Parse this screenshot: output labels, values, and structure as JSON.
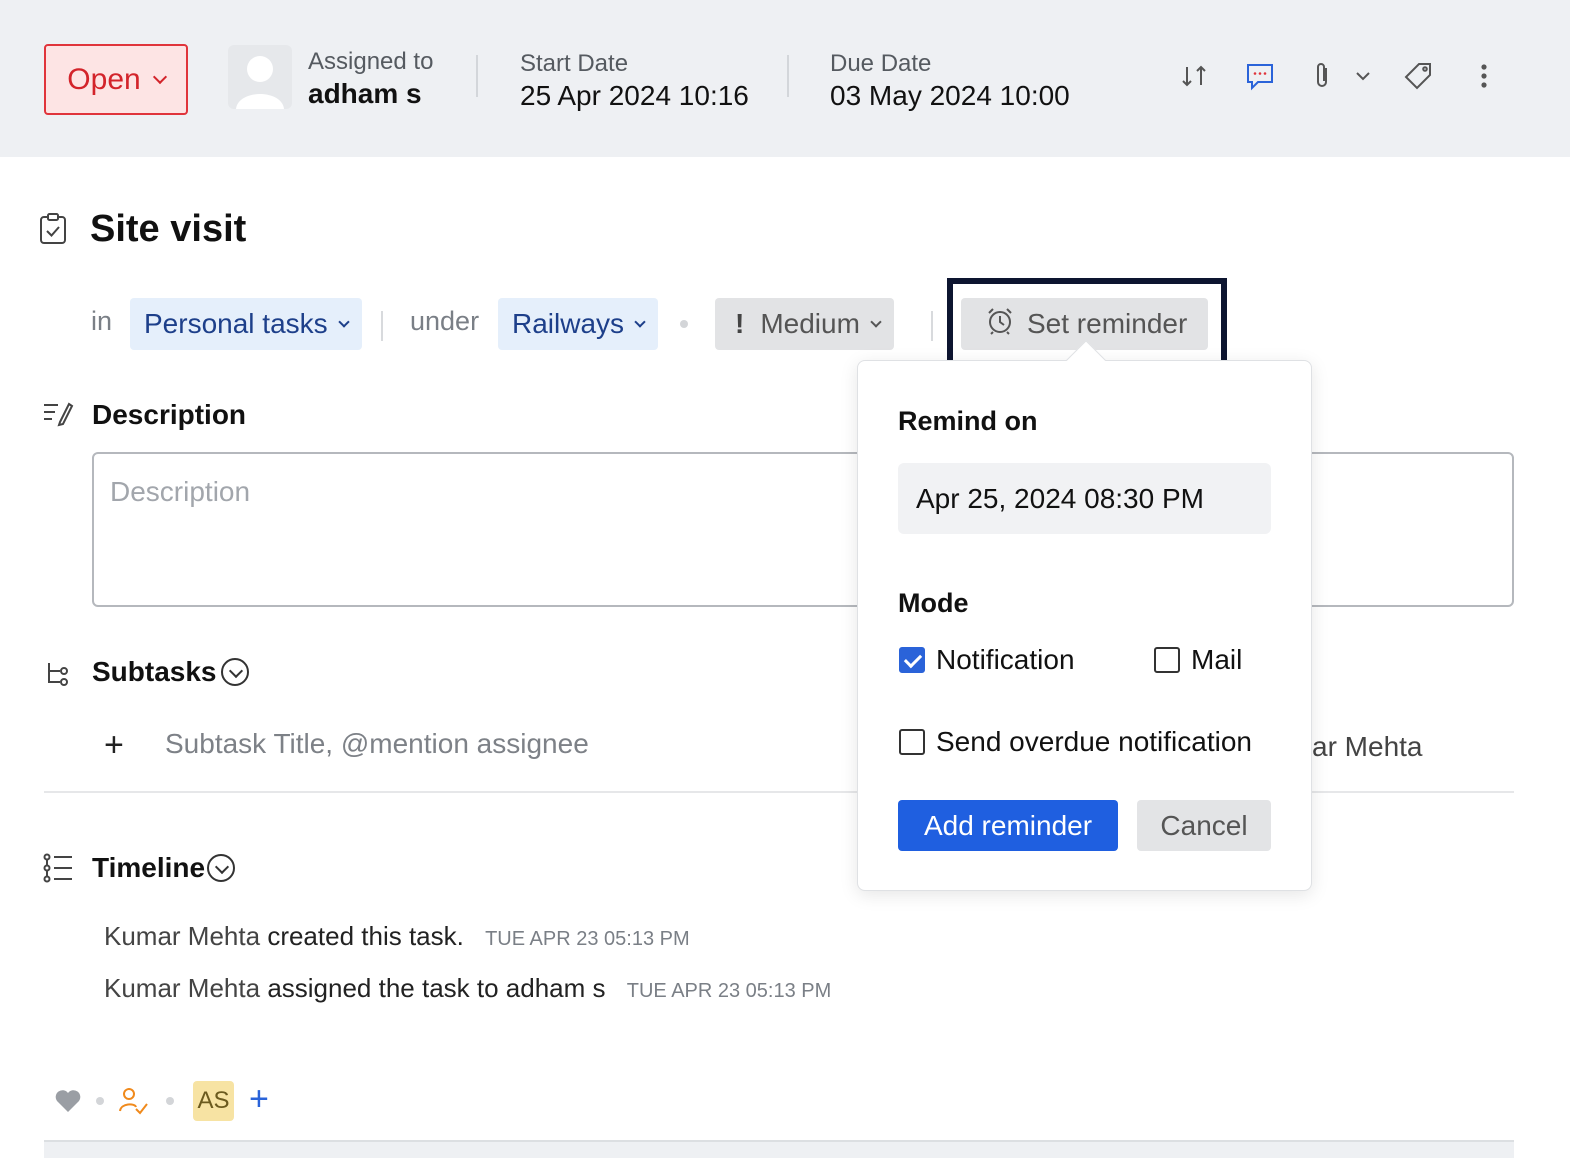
{
  "header": {
    "status": "Open",
    "assigned_label": "Assigned to",
    "assigned_value": "adham s",
    "start_label": "Start Date",
    "start_value": "25 Apr 2024 10:16",
    "due_label": "Due Date",
    "due_value": "03 May 2024 10:00",
    "icons": [
      "swap-icon",
      "comment-icon",
      "attachment-icon",
      "chevron-down-icon",
      "tag-icon",
      "more-icon"
    ]
  },
  "task": {
    "title": "Site visit",
    "in_label": "in",
    "list": "Personal tasks",
    "under_label": "under",
    "project": "Railways",
    "priority": "Medium",
    "reminder_button": "Set reminder"
  },
  "description": {
    "title": "Description",
    "placeholder": "Description"
  },
  "subtasks": {
    "title": "Subtasks",
    "input_placeholder": "Subtask Title, @mention assignee",
    "obscured_text": "ar Mehta"
  },
  "timeline": {
    "title": "Timeline",
    "entries": [
      {
        "actor": "Kumar Mehta",
        "action": "created this task.",
        "time": "TUE APR 23 05:13 PM"
      },
      {
        "actor": "Kumar Mehta",
        "action": "assigned the task to adham s",
        "time": "TUE APR 23 05:13 PM"
      }
    ]
  },
  "footer": {
    "initials": "AS",
    "add": "+"
  },
  "reminder_popover": {
    "remind_on_label": "Remind on",
    "remind_on_value": "Apr 25, 2024 08:30 PM",
    "mode_label": "Mode",
    "notification_label": "Notification",
    "notification_checked": true,
    "mail_label": "Mail",
    "mail_checked": false,
    "overdue_label": "Send overdue notification",
    "overdue_checked": false,
    "add_button": "Add reminder",
    "cancel_button": "Cancel"
  },
  "colors": {
    "status_red": "#d3242b",
    "primary_blue": "#1f5fe0",
    "chip_blue_bg": "#e5effb",
    "highlight_border": "#0d1530"
  }
}
